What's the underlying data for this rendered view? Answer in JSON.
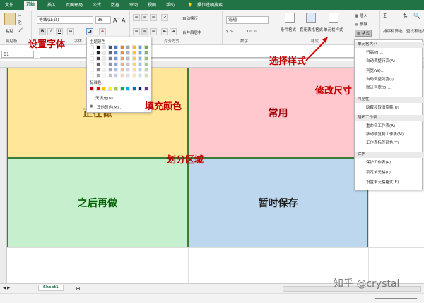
{
  "tabs": [
    {
      "label": "文件"
    },
    {
      "label": "开始"
    },
    {
      "label": "插入"
    },
    {
      "label": "页面布局"
    },
    {
      "label": "公式"
    },
    {
      "label": "数据"
    },
    {
      "label": "审阅"
    },
    {
      "label": "视图"
    },
    {
      "label": "帮助"
    },
    {
      "label": "操作说明搜索"
    }
  ],
  "ribbon": {
    "paste_label": "粘贴",
    "font_name": "等线(正文)",
    "font_size": "36",
    "wrap_text": "自动换行",
    "merge_center": "合并后居中",
    "number_format": "常规",
    "conditional_format": "条件格式",
    "table_format": "套用表格格式",
    "cell_styles": "单元格样式",
    "insert": "插入",
    "delete": "删除",
    "format": "格式",
    "sort_filter": "排序和筛选",
    "find_select": "查找和选择",
    "groups": {
      "clipboard": "剪贴板",
      "font": "字体",
      "alignment": "对齐方式",
      "number": "数字",
      "styles": "样式"
    }
  },
  "name_box": "B1",
  "cells": {
    "top_left": "正在做",
    "top_right": "常用",
    "bottom_left": "之后再做",
    "bottom_right": "暂时保存",
    "colors": {
      "top_left": "#ffe699",
      "top_right": "#ffc7ce",
      "bottom_left": "#c6efce",
      "bottom_right": "#bdd7ee"
    }
  },
  "callouts": {
    "font": "设置字体",
    "fill": "填充颜色",
    "style": "选择样式",
    "size": "修改尺寸",
    "divide": "划分区域"
  },
  "palette": {
    "theme_label": "主题颜色",
    "standard_label": "标准色",
    "no_fill": "无填充(N)",
    "more_colors": "其他颜色(M)..."
  },
  "format_menu": {
    "section_size": "单元格大小",
    "row_height": "行高(H)...",
    "autofit_row": "自动调整行高(A)",
    "col_width": "列宽(W)...",
    "autofit_col": "自动调整列宽(I)",
    "default_width": "默认列宽(D)...",
    "section_visibility": "可见性",
    "hide_unhide": "隐藏和取消隐藏(U)",
    "section_organize": "组织工作表",
    "rename_sheet": "重命名工作表(R)",
    "move_copy": "移动或复制工作表(M)...",
    "tab_color": "工作表标签颜色(T)",
    "section_protect": "保护",
    "protect_sheet": "保护工作表(P)...",
    "lock_cell": "锁定单元格(L)",
    "format_cells": "设置单元格格式(E)..."
  },
  "sheet_tab": "Sheet1",
  "watermark": "知乎 @crystal",
  "accent": "#217346"
}
